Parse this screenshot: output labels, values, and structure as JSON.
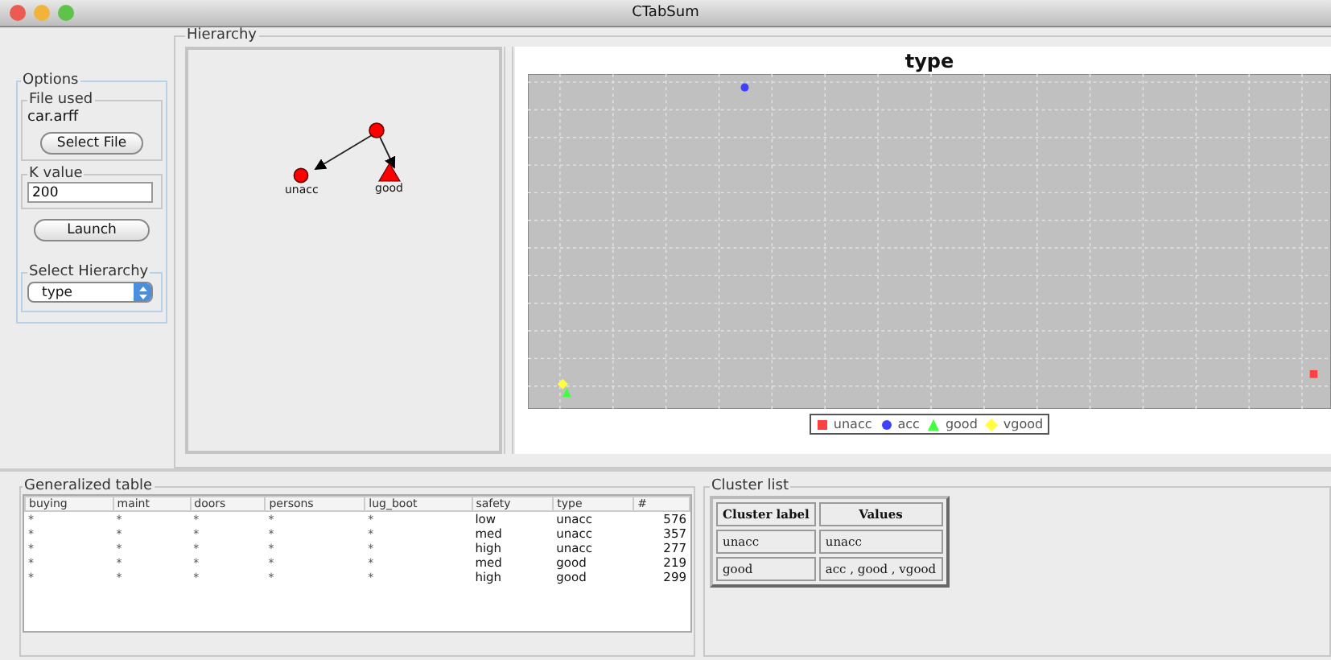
{
  "window": {
    "title": "CTabSum"
  },
  "options": {
    "title": "Options",
    "file_group": "File used",
    "file_name": "car.arff",
    "select_file_button": "Select File",
    "k_group": "K value",
    "k_value": "200",
    "launch_button": "Launch",
    "hierarchy_group": "Select Hierarchy",
    "hierarchy_value": "type"
  },
  "hierarchy": {
    "title": "Hierarchy",
    "tree": {
      "children": [
        {
          "label": "unacc",
          "kind": "circle"
        },
        {
          "label": "good",
          "kind": "triangle"
        }
      ]
    },
    "chart": {
      "title": "type",
      "legend": [
        {
          "label": "unacc",
          "color": "#ff4040",
          "kind": "square"
        },
        {
          "label": "acc",
          "color": "#4040ff",
          "kind": "circle"
        },
        {
          "label": "good",
          "color": "#40ff40",
          "kind": "triangle"
        },
        {
          "label": "vgood",
          "color": "#ffff40",
          "kind": "diamond"
        }
      ]
    }
  },
  "generalized_table": {
    "title": "Generalized table",
    "columns": [
      "buying",
      "maint",
      "doors",
      "persons",
      "lug_boot",
      "safety",
      "type",
      "#"
    ],
    "rows": [
      [
        "*",
        "*",
        "*",
        "*",
        "*",
        "low",
        "unacc",
        "576"
      ],
      [
        "*",
        "*",
        "*",
        "*",
        "*",
        "med",
        "unacc",
        "357"
      ],
      [
        "*",
        "*",
        "*",
        "*",
        "*",
        "high",
        "unacc",
        "277"
      ],
      [
        "*",
        "*",
        "*",
        "*",
        "*",
        "med",
        "good",
        "219"
      ],
      [
        "*",
        "*",
        "*",
        "*",
        "*",
        "high",
        "good",
        "299"
      ]
    ]
  },
  "cluster_list": {
    "title": "Cluster list",
    "columns": [
      "Cluster label",
      "Values"
    ],
    "rows": [
      [
        "unacc",
        "unacc"
      ],
      [
        "good",
        "acc , good , vgood"
      ]
    ]
  }
}
